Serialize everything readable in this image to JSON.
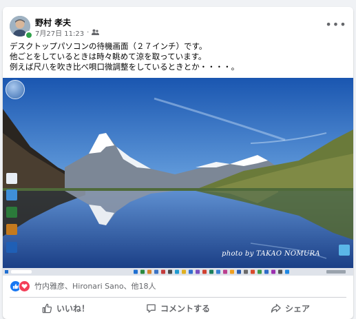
{
  "post": {
    "author": "野村 孝夫",
    "timestamp": "7月27日 11:23",
    "audience_icon": "friends-icon",
    "more_icon": "more-horizontal-icon",
    "text_lines": [
      "デスクトップパソコンの待機画面（２７インチ）です。",
      "他ごとをしているときは時々眺めて涼を取っています。",
      "例えば尺八を吹き比べ唄口微調整をしているときとか・・・・。"
    ],
    "photo": {
      "credit": "photo by  TAKAO  NOMURA"
    }
  },
  "reactions": {
    "types": [
      "like-reaction-icon",
      "love-reaction-icon"
    ],
    "summary": "竹内雅彦、Hironari Sano、他18人"
  },
  "actions": [
    {
      "icon": "like-icon",
      "label": "いいね！"
    },
    {
      "icon": "comment-icon",
      "label": "コメントする"
    },
    {
      "icon": "share-icon",
      "label": "シェア"
    }
  ],
  "colors": {
    "brand_blue": "#1877f2",
    "love_red": "#f33e58",
    "secondary_text": "#65676b",
    "online_green": "#31a24c"
  }
}
